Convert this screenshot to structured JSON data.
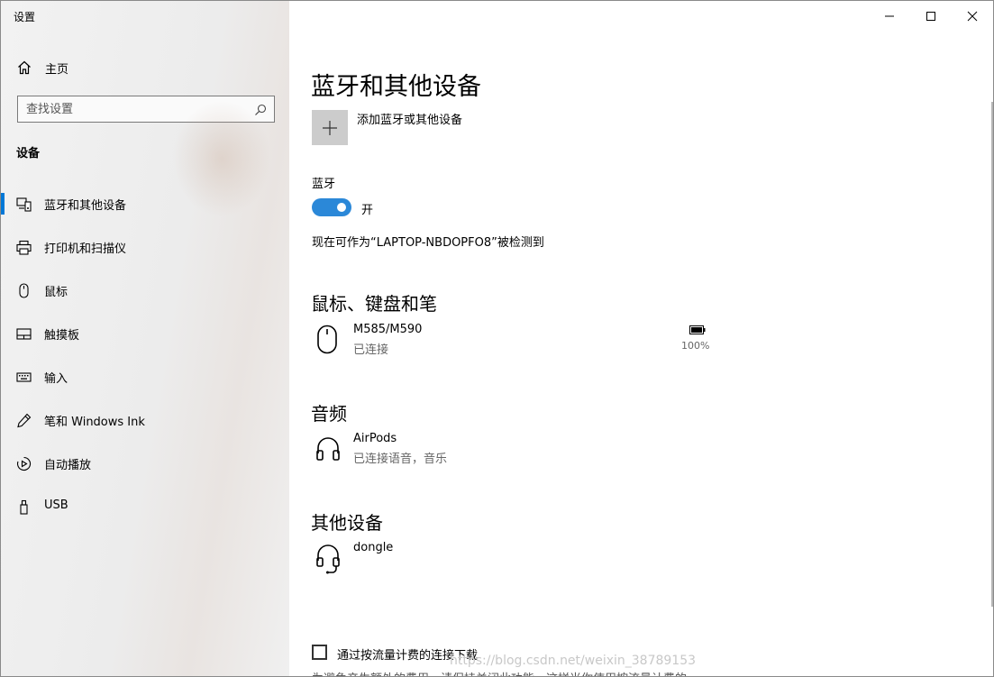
{
  "window": {
    "title": "设置",
    "controls": {
      "minimize": "minimize-icon",
      "maximize": "maximize-icon",
      "close": "close-icon"
    }
  },
  "sidebar": {
    "home": {
      "label": "主页",
      "icon": "home-icon"
    },
    "search": {
      "placeholder": "查找设置",
      "icon": "search-icon"
    },
    "section_title": "设备",
    "items": [
      {
        "label": "蓝牙和其他设备",
        "icon": "bluetooth-devices-icon",
        "active": true
      },
      {
        "label": "打印机和扫描仪",
        "icon": "printer-icon",
        "active": false
      },
      {
        "label": "鼠标",
        "icon": "mouse-icon",
        "active": false
      },
      {
        "label": "触摸板",
        "icon": "touchpad-icon",
        "active": false
      },
      {
        "label": "输入",
        "icon": "keyboard-icon",
        "active": false
      },
      {
        "label": "笔和 Windows Ink",
        "icon": "pen-icon",
        "active": false
      },
      {
        "label": "自动播放",
        "icon": "autoplay-icon",
        "active": false
      },
      {
        "label": "USB",
        "icon": "usb-icon",
        "active": false
      }
    ],
    "accent_color": "#0078d7"
  },
  "main": {
    "title": "蓝牙和其他设备",
    "add_device": {
      "label": "添加蓝牙或其他设备",
      "icon": "plus-icon"
    },
    "bluetooth": {
      "label": "蓝牙",
      "toggle_on": true,
      "state_label": "开",
      "toggle_color": "#2b88d8"
    },
    "discoverable_text": "现在可作为“LAPTOP-NBDOPFO8”被检测到",
    "groups": [
      {
        "title": "鼠标、键盘和笔",
        "devices": [
          {
            "name": "M585/M590",
            "status": "已连接",
            "icon": "mouse-icon",
            "battery": "100%"
          }
        ]
      },
      {
        "title": "音频",
        "devices": [
          {
            "name": "AirPods",
            "status": "已连接语音，音乐",
            "icon": "headphones-icon"
          }
        ]
      },
      {
        "title": "其他设备",
        "devices": [
          {
            "name": "dongle",
            "status": "",
            "icon": "headset-icon"
          }
        ]
      }
    ],
    "metered": {
      "label": "通过按流量计费的连接下载",
      "checked": false,
      "note": "为避免产生额外的费用，请保持关闭此功能，这样当你使用按流量计费的"
    }
  },
  "watermark": "https://blog.csdn.net/weixin_38789153"
}
